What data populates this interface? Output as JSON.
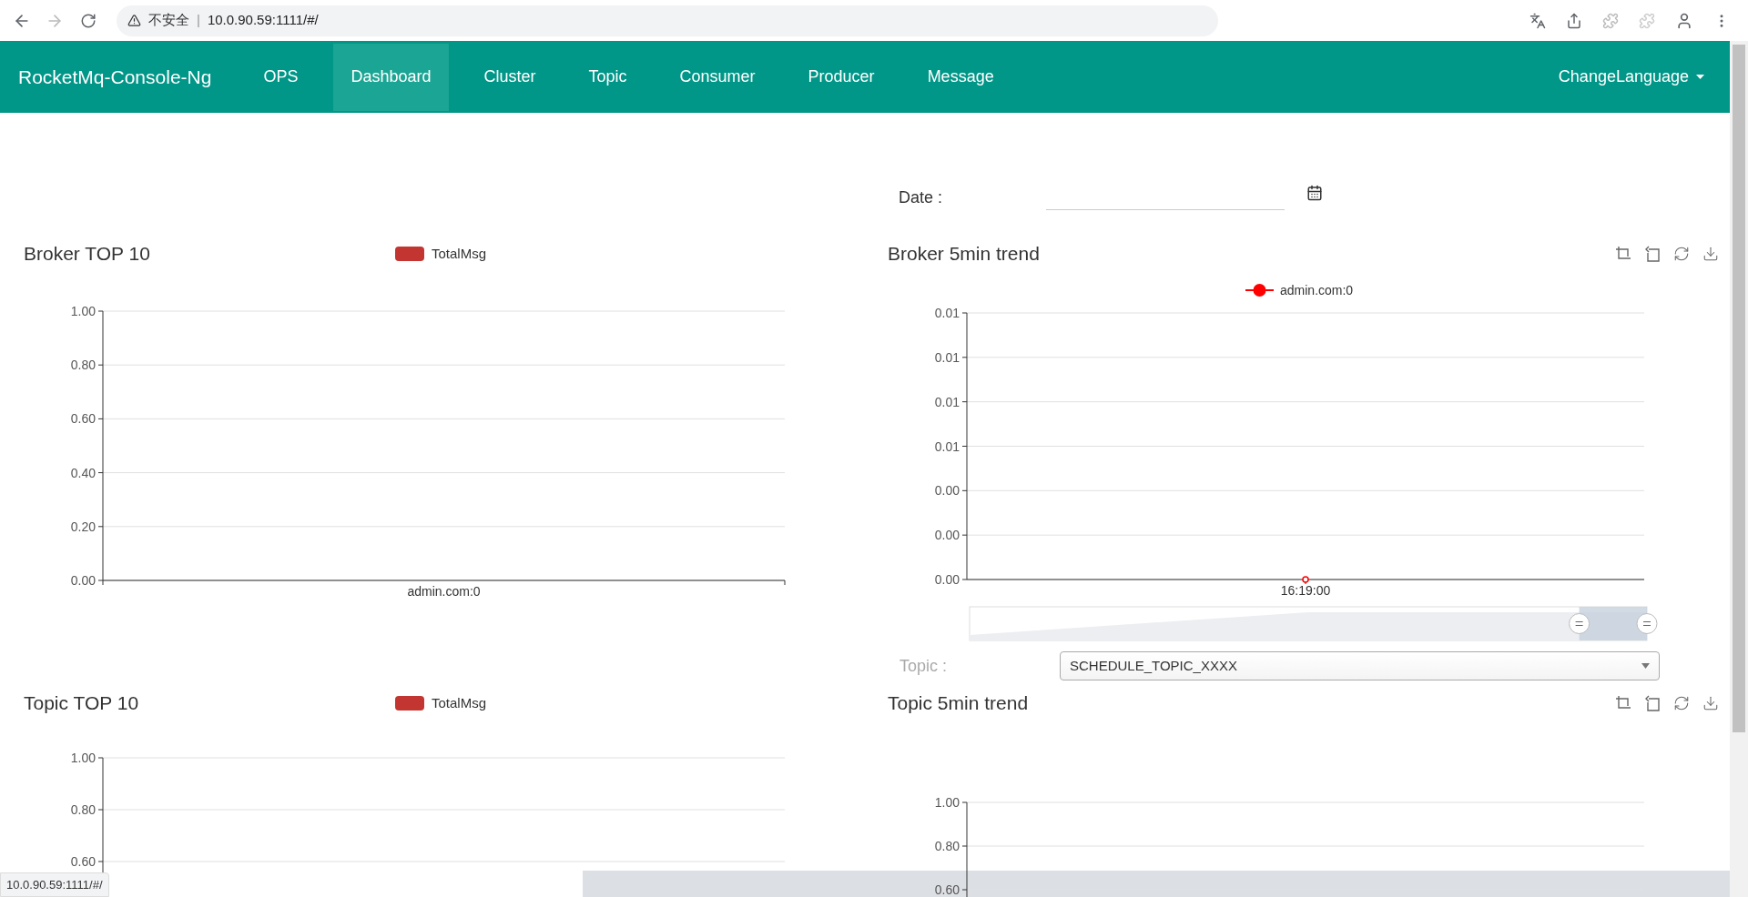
{
  "browser": {
    "security_label": "不安全",
    "separator": "|",
    "url": "10.0.90.59:1111/#/"
  },
  "navbar": {
    "brand": "RocketMq-Console-Ng",
    "items": [
      {
        "label": "OPS",
        "selected": false
      },
      {
        "label": "Dashboard",
        "selected": true
      },
      {
        "label": "Cluster",
        "selected": false
      },
      {
        "label": "Topic",
        "selected": false
      },
      {
        "label": "Consumer",
        "selected": false
      },
      {
        "label": "Producer",
        "selected": false
      },
      {
        "label": "Message",
        "selected": false
      }
    ],
    "language_menu": "ChangeLanguage"
  },
  "date_filter": {
    "label": "Date :"
  },
  "panels": [
    {
      "title": "Broker TOP 10",
      "chart_data": {
        "type": "bar",
        "grid": true,
        "categories": [
          "admin.com:0"
        ],
        "series": [
          {
            "name": "TotalMsg",
            "color": "#c23531",
            "values": [
              0
            ]
          }
        ],
        "ylim": [
          0,
          1
        ],
        "yticks": [
          {
            "value": 0,
            "label": "0.00"
          },
          {
            "value": 0.2,
            "label": "0.20"
          },
          {
            "value": 0.4,
            "label": "0.40"
          },
          {
            "value": 0.6,
            "label": "0.60"
          },
          {
            "value": 0.8,
            "label": "0.80"
          },
          {
            "value": 1,
            "label": "1.00"
          }
        ]
      }
    },
    {
      "title": "Broker 5min trend",
      "chart_data": {
        "type": "line",
        "grid": true,
        "x": [
          "16:19:00"
        ],
        "series": [
          {
            "name": "admin.com:0",
            "color": "#ff0000",
            "marker": true,
            "values": [
              0
            ]
          }
        ],
        "ylim": [
          0,
          0.012
        ],
        "yticks": [
          {
            "value": 0,
            "label": "0.00"
          },
          {
            "value": 0.002,
            "label": "0.00"
          },
          {
            "value": 0.004,
            "label": "0.00"
          },
          {
            "value": 0.006,
            "label": "0.01"
          },
          {
            "value": 0.008,
            "label": "0.01"
          },
          {
            "value": 0.01,
            "label": "0.01"
          },
          {
            "value": 0.012,
            "label": "0.01"
          }
        ]
      },
      "zoom_slider": {
        "level": 0.9
      },
      "topic_select": {
        "label": "Topic :",
        "value": "SCHEDULE_TOPIC_XXXX"
      }
    },
    {
      "title": "Topic TOP 10",
      "chart_data": {
        "type": "bar",
        "grid": true,
        "series": [
          {
            "name": "TotalMsg",
            "color": "#c23531"
          }
        ],
        "ylim": [
          0,
          1
        ],
        "yticks": [
          {
            "value": 0.6,
            "label": "0.60"
          },
          {
            "value": 0.8,
            "label": "0.80"
          },
          {
            "value": 1,
            "label": "1.00"
          }
        ]
      }
    },
    {
      "title": "Topic 5min trend",
      "chart_data": {
        "type": "line",
        "grid": true,
        "x": [
          null
        ],
        "ylim": [
          0,
          1
        ],
        "yticks": [
          {
            "value": 0.6,
            "label": "0.60"
          },
          {
            "value": 0.8,
            "label": "0.80"
          },
          {
            "value": 1,
            "label": "1.00"
          }
        ]
      }
    }
  ],
  "status_url": "10.0.90.59:1111/#/"
}
